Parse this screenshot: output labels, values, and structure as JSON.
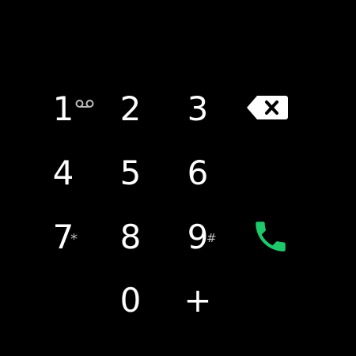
{
  "keypad": {
    "key1": {
      "digit": "1"
    },
    "key2": {
      "digit": "2"
    },
    "key3": {
      "digit": "3"
    },
    "key4": {
      "digit": "4"
    },
    "key5": {
      "digit": "5"
    },
    "key6": {
      "digit": "6"
    },
    "key7": {
      "digit": "7",
      "sub": "*"
    },
    "key8": {
      "digit": "8"
    },
    "key9": {
      "digit": "9",
      "sub": "#"
    },
    "key0": {
      "digit": "0"
    },
    "keyplus": {
      "digit": "+"
    }
  },
  "icons": {
    "voicemail": "voicemail-icon",
    "backspace": "backspace-icon",
    "call": "phone-call-icon"
  },
  "colors": {
    "background": "#000000",
    "text": "#ffffff",
    "subtext": "#bdbdbd",
    "call": "#1ec96b"
  }
}
